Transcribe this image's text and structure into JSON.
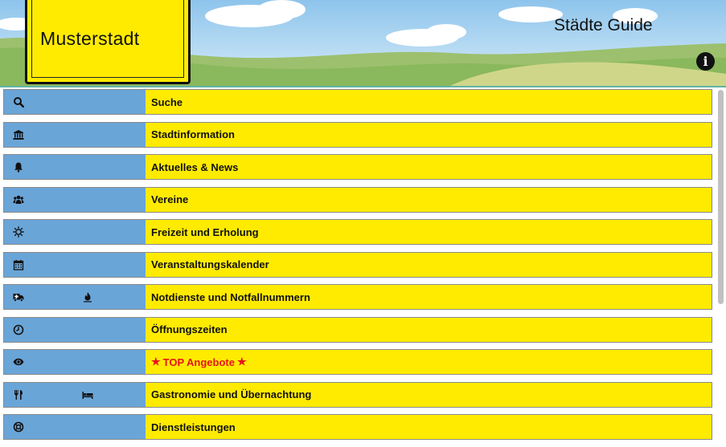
{
  "header": {
    "sign_title": "Musterstadt",
    "app_title": "Städte Guide",
    "info_icon": "info-circle-icon"
  },
  "menu": {
    "items": [
      {
        "label": "Suche",
        "icons": [
          "search-icon"
        ]
      },
      {
        "label": "Stadtinformation",
        "icons": [
          "bank-icon"
        ]
      },
      {
        "label": "Aktuelles & News",
        "icons": [
          "bell-icon"
        ]
      },
      {
        "label": "Vereine",
        "icons": [
          "users-icon"
        ]
      },
      {
        "label": "Freizeit und Erholung",
        "icons": [
          "sun-icon"
        ]
      },
      {
        "label": "Veranstaltungskalender",
        "icons": [
          "calendar-icon"
        ]
      },
      {
        "label": "Notdienste und Notfallnummern",
        "icons": [
          "ambulance-icon",
          "fire-icon"
        ]
      },
      {
        "label": "Öffnungszeiten",
        "icons": [
          "clock-icon"
        ]
      },
      {
        "label": "TOP Angebote",
        "icons": [
          "eye-icon"
        ],
        "star_icons": [
          "star-icon",
          "star-icon"
        ]
      },
      {
        "label": "Gastronomie und Übernachtung",
        "icons": [
          "cutlery-icon",
          "bed-icon"
        ]
      },
      {
        "label": "Dienstleistungen",
        "icons": [
          "lifebuoy-icon"
        ]
      }
    ]
  },
  "colors": {
    "sign_yellow": "#ffeb00",
    "icon_cell_blue": "#6aa5d8",
    "highlight_red": "#e8141b"
  }
}
